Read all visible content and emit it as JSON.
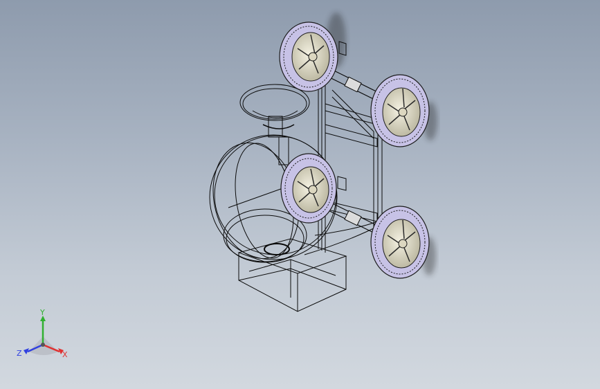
{
  "viewport": {
    "background_top": "#8e9bad",
    "background_bottom": "#d2d8df"
  },
  "model": {
    "render_mode": "wireframe",
    "line_color": "#0a0a0a",
    "wheel_tire_color": "#c7c2e6",
    "wheel_hub_color": "#e8e4d0"
  },
  "triad": {
    "x_label": "X",
    "y_label": "Y",
    "z_label": "Z",
    "x_color": "#e03030",
    "y_color": "#30b030",
    "z_color": "#3040e0"
  }
}
